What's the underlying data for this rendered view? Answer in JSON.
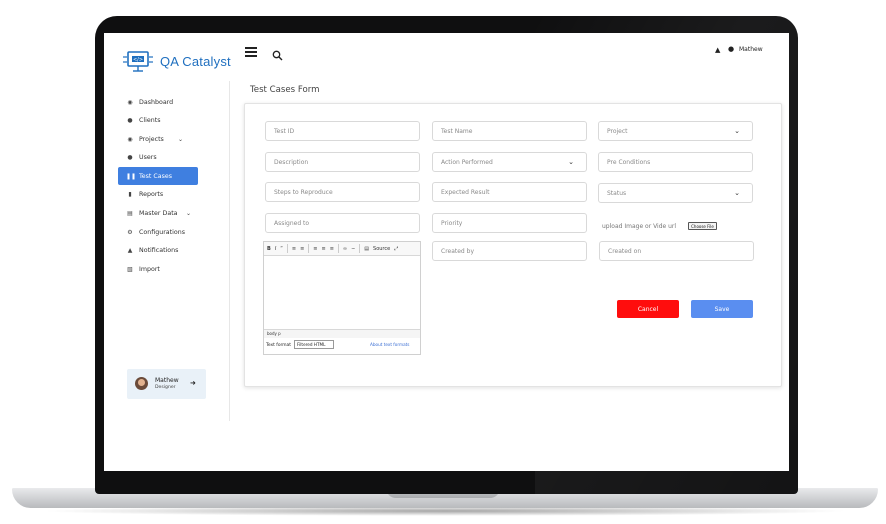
{
  "app": {
    "name": "QA Catalyst"
  },
  "sidebar": {
    "items": [
      {
        "label": "Dashboard",
        "icon": "dashboard-icon"
      },
      {
        "label": "Clients",
        "icon": "person-icon"
      },
      {
        "label": "Projects",
        "icon": "projects-icon",
        "expandable": true
      },
      {
        "label": "Users",
        "icon": "person-icon"
      },
      {
        "label": "Test Cases",
        "icon": "test-cases-icon",
        "active": true
      },
      {
        "label": "Reports",
        "icon": "report-icon"
      },
      {
        "label": "Master Data",
        "icon": "master-data-icon",
        "expandable": true
      },
      {
        "label": "Configurations",
        "icon": "gear-icon"
      },
      {
        "label": "Notifications",
        "icon": "bell-icon"
      },
      {
        "label": "Import",
        "icon": "import-icon"
      }
    ],
    "profile": {
      "name": "Mathew",
      "role": "Designer"
    }
  },
  "header": {
    "user_name": "Mathew"
  },
  "page": {
    "title": "Test Cases Form"
  },
  "form": {
    "test_id": "Test ID",
    "test_name": "Test Name",
    "project": "Project",
    "description": "Description",
    "action_performed": "Action Performed",
    "pre_conditions": "Pre Conditions",
    "steps": "Steps to Reproduce",
    "expected_result": "Expected Result",
    "status": "Status",
    "assigned_to": "Assigned to",
    "priority": "Priority",
    "upload_label": "upload Image or Vide url",
    "choose_file": "Choose File",
    "created_by": "Created by",
    "created_on": "Created on",
    "cancel": "Cancel",
    "save": "Save"
  },
  "editor": {
    "source_label": "Source",
    "path": "body  p",
    "format_label": "Text format",
    "format_value": "Filtered HTML",
    "about_link": "About text formats"
  },
  "colors": {
    "accent": "#3f7fe0",
    "cancel": "#ff0d0d",
    "save": "#5a8ef0",
    "logo": "#1f6fbf"
  }
}
